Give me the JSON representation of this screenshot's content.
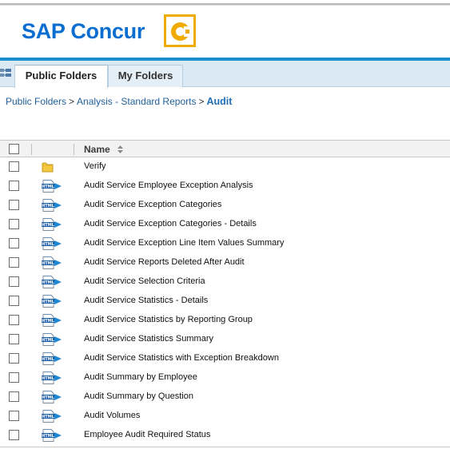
{
  "brand": {
    "name": "SAP Concur",
    "accent": "#0a6ed1",
    "mark_color": "#f0ab00",
    "bar_color": "#1b8fd0"
  },
  "tabs": [
    {
      "label": "Public Folders",
      "active": true
    },
    {
      "label": "My Folders",
      "active": false
    }
  ],
  "breadcrumb": {
    "items": [
      "Public Folders",
      "Analysis - Standard Reports"
    ],
    "separator": ">",
    "current": "Audit"
  },
  "grid": {
    "columns": {
      "name": "Name"
    },
    "rows": [
      {
        "type": "folder",
        "name": "Verify"
      },
      {
        "type": "report",
        "name": "Audit Service Employee Exception Analysis"
      },
      {
        "type": "report",
        "name": "Audit Service Exception Categories"
      },
      {
        "type": "report",
        "name": "Audit Service Exception Categories - Details"
      },
      {
        "type": "report",
        "name": "Audit Service Exception Line Item Values Summary"
      },
      {
        "type": "report",
        "name": "Audit Service Reports Deleted After Audit"
      },
      {
        "type": "report",
        "name": "Audit Service Selection Criteria"
      },
      {
        "type": "report",
        "name": "Audit Service Statistics - Details"
      },
      {
        "type": "report",
        "name": "Audit Service Statistics by Reporting Group"
      },
      {
        "type": "report",
        "name": "Audit Service Statistics Summary"
      },
      {
        "type": "report",
        "name": "Audit Service Statistics with Exception Breakdown"
      },
      {
        "type": "report",
        "name": "Audit Summary by Employee"
      },
      {
        "type": "report",
        "name": "Audit Summary by Question"
      },
      {
        "type": "report",
        "name": "Audit Volumes"
      },
      {
        "type": "report",
        "name": "Employee Audit Required Status"
      }
    ]
  }
}
